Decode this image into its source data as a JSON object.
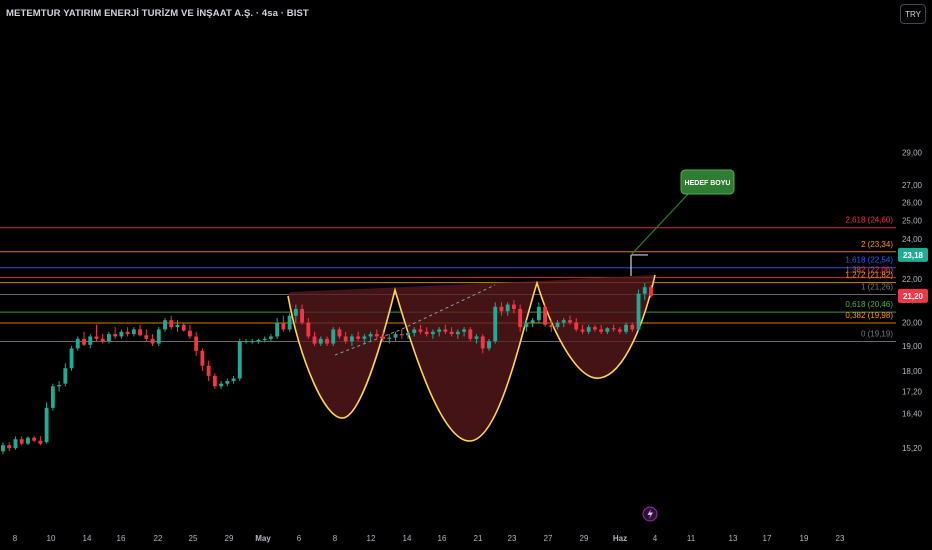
{
  "header": {
    "title": "METEMTUR YATIRIM ENERJİ TURİZM VE İNŞAAT A.Ş. · 4sa · BIST",
    "currency": "TRY"
  },
  "colors": {
    "background": "#000000",
    "up": "#22ab94",
    "down": "#f23645",
    "cup_fill": "#5a1a1e",
    "cup_stroke": "#ffd54f",
    "target_box": "#2e7d32",
    "grid_text": "#b2b5be"
  },
  "chart_data": {
    "type": "candlestick",
    "y_axis": {
      "scale": "log",
      "range": [
        14.9,
        30.3
      ],
      "ticks": [
        "15,20",
        "16,40",
        "17,20",
        "18,00",
        "19,00",
        "20,00",
        "21,00",
        "22,00",
        "24,00",
        "25,00",
        "26,00",
        "27,00",
        "29,00"
      ]
    },
    "x_axis": {
      "ticks": [
        "8",
        "10",
        "14",
        "16",
        "22",
        "25",
        "29",
        "May",
        "6",
        "8",
        "12",
        "14",
        "16",
        "21",
        "23",
        "27",
        "29",
        "Haz",
        "4",
        "11",
        "13",
        "17",
        "19",
        "23"
      ]
    },
    "price_badges": [
      {
        "label": "23,18",
        "value": 23.18,
        "color": "#22ab94"
      },
      {
        "label": "21,20",
        "value": 21.2,
        "color": "#f23645"
      }
    ],
    "fibonacci": [
      {
        "label": "2,618 (24,60)",
        "value": 24.6,
        "color": "#f23645"
      },
      {
        "label": "2 (23,34)",
        "value": 23.34,
        "color": "#ff9800"
      },
      {
        "label": "1,618 (22,54)",
        "value": 22.54,
        "color": "#2962ff"
      },
      {
        "label": "1,382 (22,06)",
        "value": 22.06,
        "color": "#f23645"
      },
      {
        "label": "1,272 (21,82)",
        "value": 21.82,
        "color": "#ff9800"
      },
      {
        "label": "1 (21,26)",
        "value": 21.26,
        "color": "#787b86"
      },
      {
        "label": "0,618 (20,46)",
        "value": 20.46,
        "color": "#4caf50"
      },
      {
        "label": "0,382 (19,98)",
        "value": 19.98,
        "color": "#ff9800"
      },
      {
        "label": "0 (19,19)",
        "value": 19.19,
        "color": "#787b86"
      }
    ],
    "annotation": {
      "label": "HEDEF BOYU"
    },
    "candles": [
      [
        15.1,
        15.4,
        15.0,
        15.3
      ],
      [
        15.3,
        15.4,
        15.1,
        15.2
      ],
      [
        15.2,
        15.6,
        15.15,
        15.5
      ],
      [
        15.5,
        15.6,
        15.3,
        15.35
      ],
      [
        15.35,
        15.6,
        15.3,
        15.55
      ],
      [
        15.55,
        15.6,
        15.4,
        15.45
      ],
      [
        15.45,
        15.6,
        15.3,
        15.35
      ],
      [
        15.4,
        16.8,
        15.35,
        16.6
      ],
      [
        16.6,
        17.5,
        16.5,
        17.4
      ],
      [
        17.4,
        17.6,
        17.2,
        17.45
      ],
      [
        17.5,
        18.3,
        17.4,
        18.1
      ],
      [
        18.1,
        19.0,
        18.0,
        18.9
      ],
      [
        18.9,
        19.4,
        18.8,
        19.3
      ],
      [
        19.3,
        19.6,
        19.0,
        19.05
      ],
      [
        19.05,
        19.5,
        18.9,
        19.4
      ],
      [
        19.4,
        19.9,
        19.2,
        19.3
      ],
      [
        19.3,
        19.5,
        19.1,
        19.2
      ],
      [
        19.2,
        19.6,
        19.1,
        19.5
      ],
      [
        19.5,
        19.8,
        19.3,
        19.4
      ],
      [
        19.4,
        19.7,
        19.3,
        19.6
      ],
      [
        19.6,
        19.8,
        19.4,
        19.5
      ],
      [
        19.5,
        19.8,
        19.4,
        19.7
      ],
      [
        19.7,
        19.9,
        19.4,
        19.45
      ],
      [
        19.45,
        19.7,
        19.2,
        19.3
      ],
      [
        19.3,
        19.5,
        19.0,
        19.1
      ],
      [
        19.1,
        19.8,
        19.0,
        19.7
      ],
      [
        19.7,
        20.2,
        19.6,
        20.1
      ],
      [
        20.1,
        20.3,
        19.7,
        19.8
      ],
      [
        19.8,
        20.1,
        19.6,
        19.9
      ],
      [
        19.9,
        20.0,
        19.6,
        19.65
      ],
      [
        19.65,
        19.9,
        19.3,
        19.4
      ],
      [
        19.4,
        19.6,
        18.6,
        18.8
      ],
      [
        18.8,
        18.9,
        18.0,
        18.2
      ],
      [
        18.2,
        18.4,
        17.6,
        17.8
      ],
      [
        17.8,
        17.9,
        17.3,
        17.4
      ],
      [
        17.4,
        17.6,
        17.3,
        17.5
      ],
      [
        17.5,
        17.7,
        17.4,
        17.6
      ],
      [
        17.6,
        17.8,
        17.5,
        17.7
      ],
      [
        17.7,
        19.3,
        17.6,
        19.2
      ],
      [
        19.2,
        19.3,
        19.1,
        19.2
      ],
      [
        19.2,
        19.3,
        19.1,
        19.2
      ],
      [
        19.2,
        19.3,
        19.1,
        19.25
      ],
      [
        19.25,
        19.4,
        19.15,
        19.3
      ],
      [
        19.3,
        19.5,
        19.2,
        19.4
      ],
      [
        19.4,
        20.2,
        19.3,
        20.0
      ],
      [
        20.0,
        20.3,
        19.6,
        19.7
      ],
      [
        19.7,
        20.4,
        19.6,
        20.3
      ],
      [
        20.3,
        20.8,
        20.0,
        20.6
      ],
      [
        20.6,
        20.8,
        19.9,
        20.0
      ],
      [
        20.0,
        20.2,
        19.3,
        19.4
      ],
      [
        19.4,
        19.6,
        19.0,
        19.1
      ],
      [
        19.1,
        19.4,
        19.0,
        19.3
      ],
      [
        19.3,
        19.4,
        19.0,
        19.1
      ],
      [
        19.1,
        19.8,
        19.0,
        19.7
      ],
      [
        19.7,
        19.8,
        19.3,
        19.4
      ],
      [
        19.4,
        19.6,
        19.1,
        19.2
      ],
      [
        19.2,
        19.5,
        19.0,
        19.4
      ],
      [
        19.4,
        19.6,
        19.2,
        19.3
      ],
      [
        19.3,
        19.5,
        19.1,
        19.4
      ],
      [
        19.4,
        19.6,
        19.2,
        19.5
      ],
      [
        19.5,
        19.7,
        19.3,
        19.4
      ],
      [
        19.4,
        19.6,
        19.2,
        19.3
      ],
      [
        19.3,
        19.5,
        19.1,
        19.35
      ],
      [
        19.35,
        19.6,
        19.2,
        19.5
      ],
      [
        19.5,
        19.7,
        19.3,
        19.45
      ],
      [
        19.45,
        19.6,
        19.3,
        19.55
      ],
      [
        19.55,
        19.8,
        19.4,
        19.7
      ],
      [
        19.7,
        19.9,
        19.5,
        19.6
      ],
      [
        19.6,
        19.8,
        19.4,
        19.5
      ],
      [
        19.5,
        19.7,
        19.3,
        19.6
      ],
      [
        19.6,
        19.8,
        19.4,
        19.7
      ],
      [
        19.7,
        19.9,
        19.5,
        19.6
      ],
      [
        19.6,
        19.8,
        19.4,
        19.5
      ],
      [
        19.5,
        19.7,
        19.3,
        19.6
      ],
      [
        19.6,
        19.8,
        19.4,
        19.7
      ],
      [
        19.7,
        19.8,
        19.2,
        19.3
      ],
      [
        19.3,
        19.5,
        19.1,
        19.4
      ],
      [
        19.4,
        19.5,
        18.7,
        18.9
      ],
      [
        18.9,
        19.3,
        18.8,
        19.2
      ],
      [
        19.2,
        20.9,
        19.1,
        20.7
      ],
      [
        20.7,
        20.9,
        20.3,
        20.5
      ],
      [
        20.5,
        20.9,
        20.3,
        20.8
      ],
      [
        20.8,
        21.0,
        20.4,
        20.6
      ],
      [
        20.6,
        20.8,
        19.6,
        19.8
      ],
      [
        19.8,
        20.1,
        19.6,
        20.0
      ],
      [
        20.0,
        20.2,
        19.8,
        20.1
      ],
      [
        20.1,
        20.9,
        20.0,
        20.7
      ],
      [
        20.7,
        20.8,
        19.8,
        19.9
      ],
      [
        19.9,
        20.1,
        19.6,
        19.8
      ],
      [
        19.8,
        20.1,
        19.7,
        20.0
      ],
      [
        20.0,
        20.2,
        19.8,
        20.1
      ],
      [
        20.1,
        20.3,
        19.9,
        20.0
      ],
      [
        20.0,
        20.2,
        19.6,
        19.7
      ],
      [
        19.7,
        19.9,
        19.5,
        19.6
      ],
      [
        19.6,
        19.9,
        19.5,
        19.8
      ],
      [
        19.8,
        19.9,
        19.6,
        19.7
      ],
      [
        19.7,
        19.9,
        19.5,
        19.6
      ],
      [
        19.6,
        19.8,
        19.5,
        19.75
      ],
      [
        19.75,
        19.9,
        19.6,
        19.7
      ],
      [
        19.7,
        19.8,
        19.5,
        19.6
      ],
      [
        19.6,
        20.0,
        19.5,
        19.9
      ],
      [
        19.9,
        20.0,
        19.6,
        19.7
      ],
      [
        19.7,
        21.5,
        19.6,
        21.3
      ],
      [
        21.3,
        21.8,
        21.0,
        21.6
      ],
      [
        21.6,
        21.7,
        21.1,
        21.2
      ]
    ]
  }
}
